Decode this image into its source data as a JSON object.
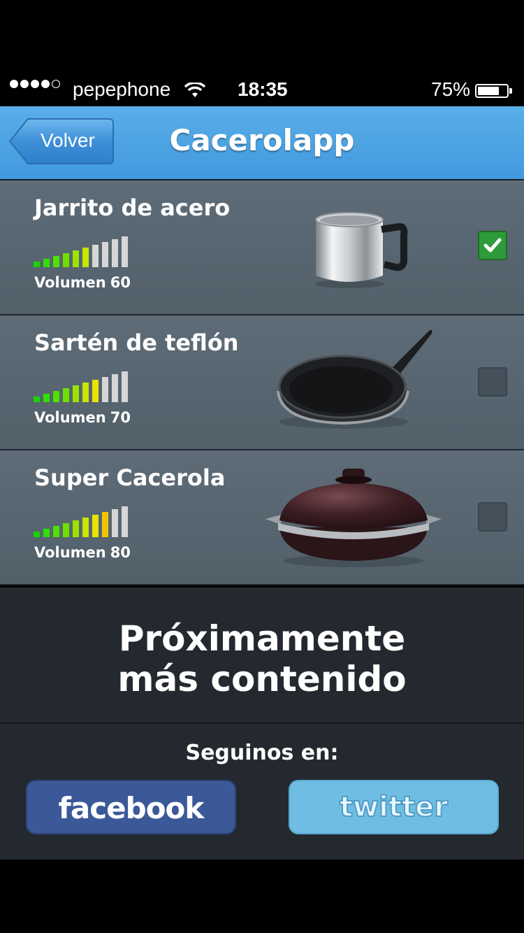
{
  "status_bar": {
    "carrier": "pepephone",
    "time": "18:35",
    "battery": "75%",
    "signal_bars": 4,
    "signal_total": 5,
    "battery_level": 0.75
  },
  "nav": {
    "back_label": "Volver",
    "title": "Cacerolapp",
    "color": "#4a9fe0"
  },
  "items": [
    {
      "name": "Jarrito de acero",
      "volume_label": "Volumen",
      "volume": "60",
      "volume_level": 6,
      "checked": true,
      "icon": "milk-pot-icon"
    },
    {
      "name": "Sartén de teflón",
      "volume_label": "Volumen",
      "volume": "70",
      "volume_level": 7,
      "checked": false,
      "icon": "frying-pan-icon"
    },
    {
      "name": "Super Cacerola",
      "volume_label": "Volumen",
      "volume": "80",
      "volume_level": 8,
      "checked": false,
      "icon": "casserole-icon"
    }
  ],
  "meter_total": 10,
  "meter_colors": [
    "#19d400",
    "#2fe000",
    "#4ee200",
    "#6fe000",
    "#9ae400",
    "#c8e600",
    "#ebe400",
    "#f2c400",
    "#d6d6d6",
    "#d6d6d6"
  ],
  "coming_soon": {
    "line1": "Próximamente",
    "line2": "más contenido"
  },
  "follow": {
    "label": "Seguinos en:",
    "facebook": "facebook",
    "twitter": "twitter",
    "facebook_color": "#3b5998",
    "twitter_color": "#6fbde2"
  }
}
